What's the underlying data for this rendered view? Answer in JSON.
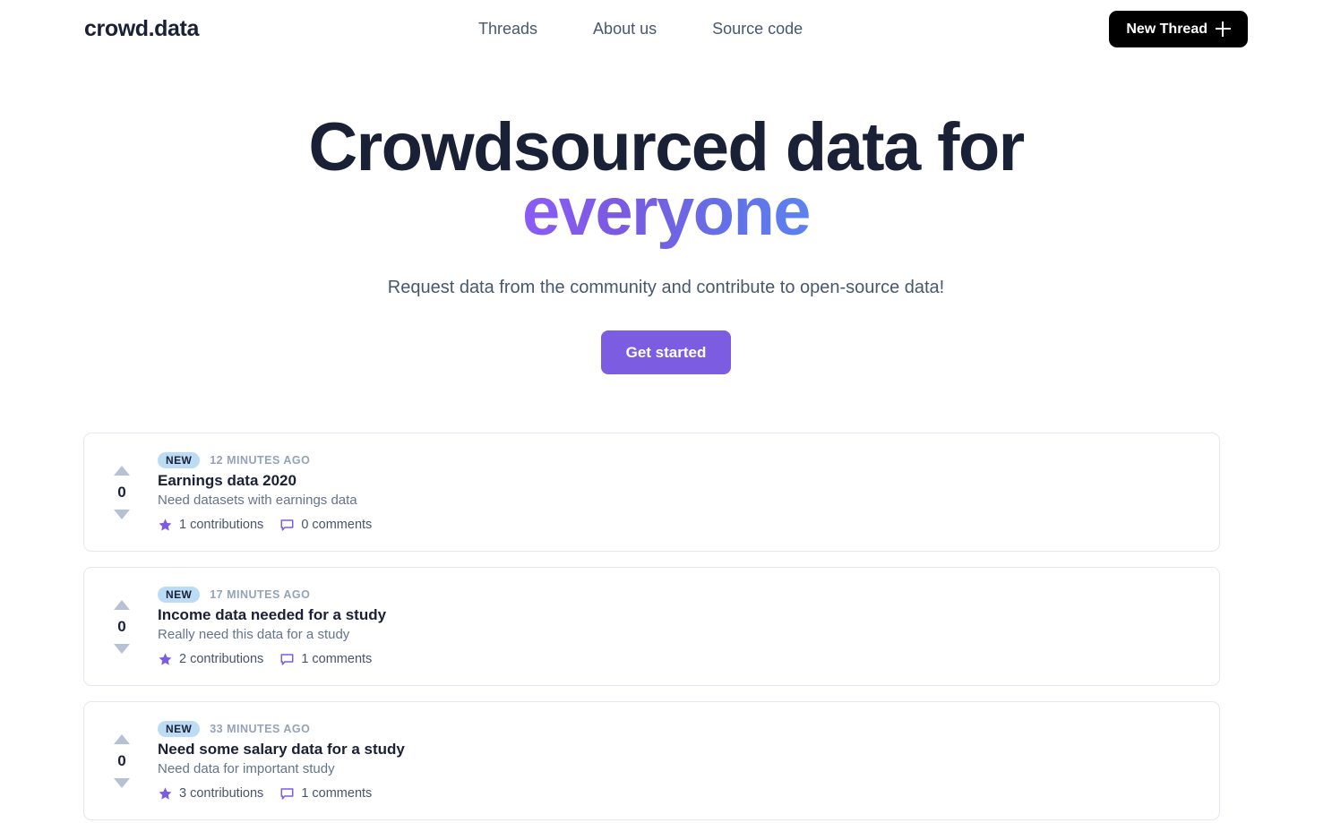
{
  "header": {
    "logo": "crowd.data",
    "nav": [
      {
        "label": "Threads",
        "name": "nav-threads"
      },
      {
        "label": "About us",
        "name": "nav-about-us"
      },
      {
        "label": "Source code",
        "name": "nav-source-code"
      }
    ],
    "new_thread_label": "New Thread",
    "new_thread_icon": "plus-icon",
    "new_thread_bg": "#000000"
  },
  "hero": {
    "title_line1": "Crowdsourced data for",
    "title_accent": "everyone",
    "subtitle": "Request data from the community and contribute to open-source data!",
    "cta_label": "Get started",
    "cta_bg": "#7c5ce0",
    "accent_gradient_from": "#8b5cf6",
    "accent_gradient_to": "#5b83ef"
  },
  "threads": [
    {
      "badge": "NEW",
      "timestamp": "12 MINUTES AGO",
      "title": "Earnings data 2020",
      "description": "Need datasets with earnings data",
      "votes": "0",
      "contributions": "1 contributions",
      "comments": "0 comments"
    },
    {
      "badge": "NEW",
      "timestamp": "17 MINUTES AGO",
      "title": "Income data needed for a study",
      "description": "Really need this data for a study",
      "votes": "0",
      "contributions": "2 contributions",
      "comments": "1 comments"
    },
    {
      "badge": "NEW",
      "timestamp": "33 MINUTES AGO",
      "title": "Need some salary data for a study",
      "description": "Need data for important study",
      "votes": "0",
      "contributions": "3 contributions",
      "comments": "1 comments"
    }
  ],
  "colors": {
    "badge_bg": "#bcdcf6",
    "accent_purple": "#7c5ce0",
    "card_border": "#e3e8f0",
    "text_dark": "#1a2035",
    "text_muted": "#64748b"
  }
}
